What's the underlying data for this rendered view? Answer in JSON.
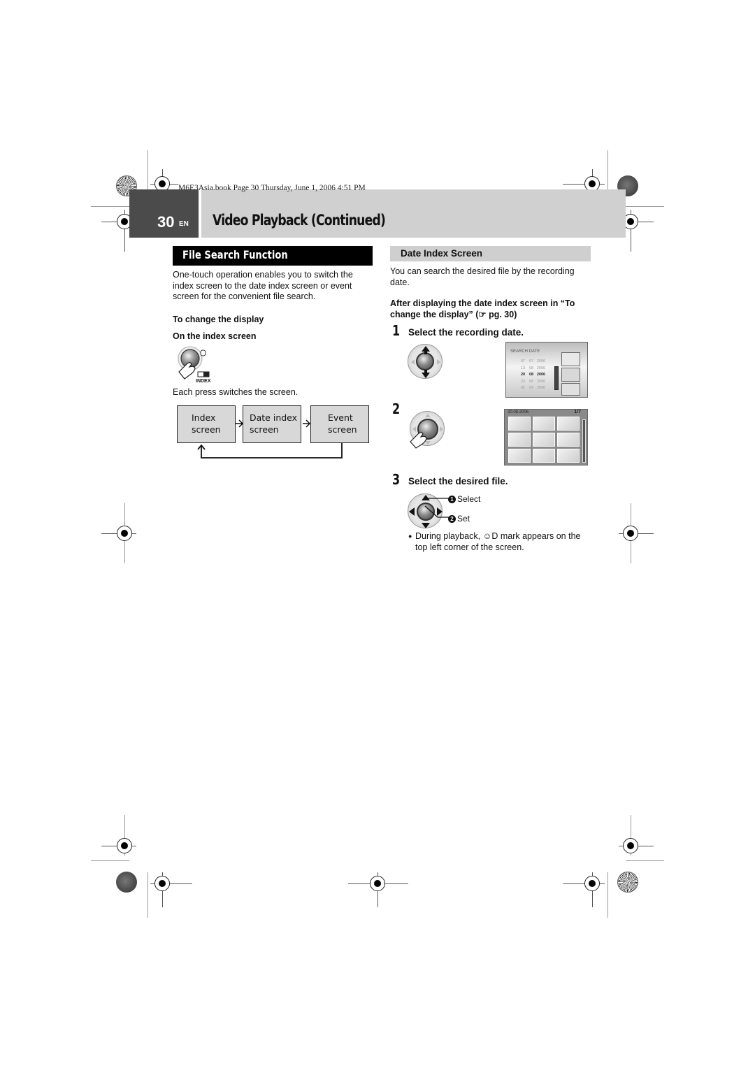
{
  "print_info": "M6E3Asia.book  Page 30  Thursday, June 1, 2006  4:51 PM",
  "header": {
    "page_number": "30",
    "language": "EN",
    "title": "Video Playback (Continued)"
  },
  "left": {
    "section_title": "File Search Function",
    "intro": "One-touch operation enables you to switch the index screen to the date index screen or event screen for the convenient file search.",
    "subheading_1": "To change the display",
    "subheading_2": "On the index screen",
    "button_label": "INDEX",
    "press_note": "Each press switches the screen.",
    "flow": [
      {
        "line1": "Index",
        "line2": "screen"
      },
      {
        "line1": "Date index",
        "line2": "screen"
      },
      {
        "line1": "Event",
        "line2": "screen"
      }
    ]
  },
  "right": {
    "section_title": "Date Index Screen",
    "intro": "You can search the desired file by the recording date.",
    "prereq": "After displaying the date index screen in “To change the display” (☞ pg. 30)",
    "steps": [
      {
        "num": "1",
        "text": "Select the recording date."
      },
      {
        "num": "2",
        "text": ""
      },
      {
        "num": "3",
        "text": "Select the desired file."
      }
    ],
    "lcd1": {
      "title": "SEARCH DATE",
      "rows": [
        [
          "07",
          "07",
          "2006"
        ],
        [
          "13",
          "08",
          "2006"
        ],
        [
          "20",
          "08",
          "2006"
        ],
        [
          "23",
          "08",
          "2006"
        ],
        [
          "02",
          "09",
          "2006"
        ]
      ],
      "selected_row": 2
    },
    "lcd2": {
      "date": "20.08.2006",
      "page": "1/7"
    },
    "callouts": [
      {
        "num": "1",
        "label": "Select"
      },
      {
        "num": "2",
        "label": "Set"
      }
    ],
    "note": "During playback, ☺D mark appears on the top left corner of the screen."
  }
}
